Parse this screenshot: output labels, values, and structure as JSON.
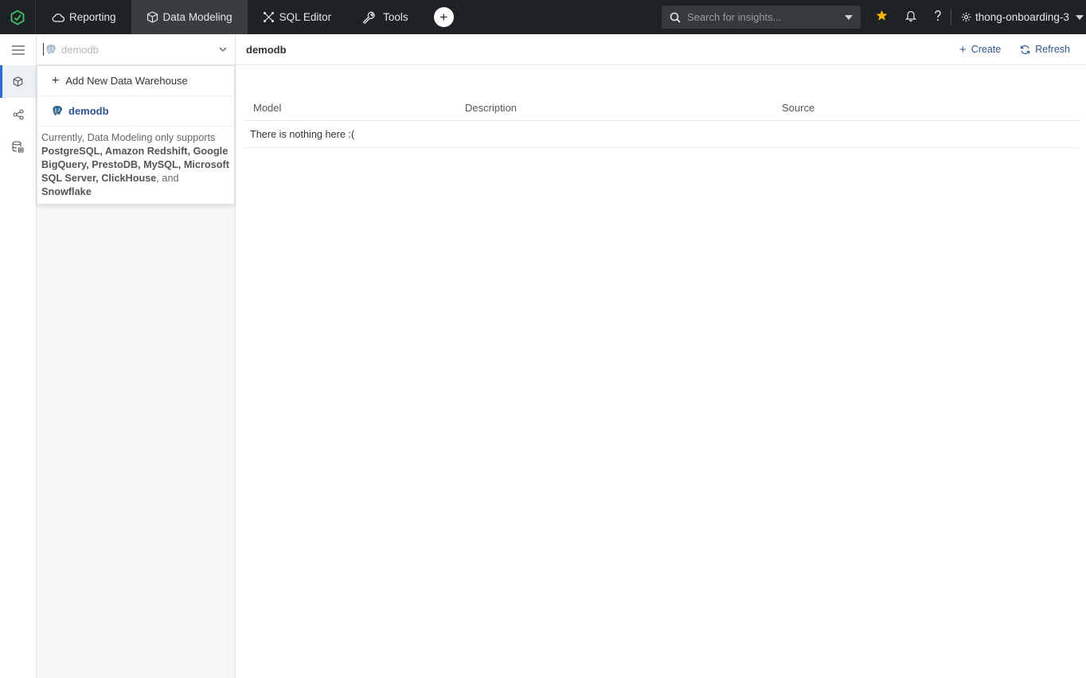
{
  "nav": {
    "tabs": [
      {
        "label": "Reporting",
        "icon": "cloud-icon"
      },
      {
        "label": "Data Modeling",
        "icon": "cube-icon",
        "active": true
      },
      {
        "label": "SQL Editor",
        "icon": "sql-editor-icon"
      },
      {
        "label": "Tools",
        "icon": "wrench-icon"
      }
    ],
    "search_placeholder": "Search for insights...",
    "workspace": "thong-onboarding-3"
  },
  "colors": {
    "topbar": "#1f2224",
    "active_tab": "#393d40",
    "accent": "#2b6fd3",
    "link": "#2e5590",
    "star": "#f5b400"
  },
  "sidebar": {
    "select_placeholder": "demodb",
    "dropdown": {
      "add_label": "Add New Data Warehouse",
      "db_item": "demodb",
      "note_prefix": "Currently, Data Modeling only supports ",
      "note_supported": "PostgreSQL, Amazon Redshift, Google BigQuery, PrestoDB, MySQL, Microsoft SQL Server, ClickHouse",
      "note_and": ", and ",
      "note_last": "Snowflake"
    }
  },
  "main": {
    "title": "demodb",
    "create_label": "Create",
    "refresh_label": "Refresh",
    "columns": [
      "Model",
      "Description",
      "Source"
    ],
    "empty_text": "There is nothing here :("
  }
}
